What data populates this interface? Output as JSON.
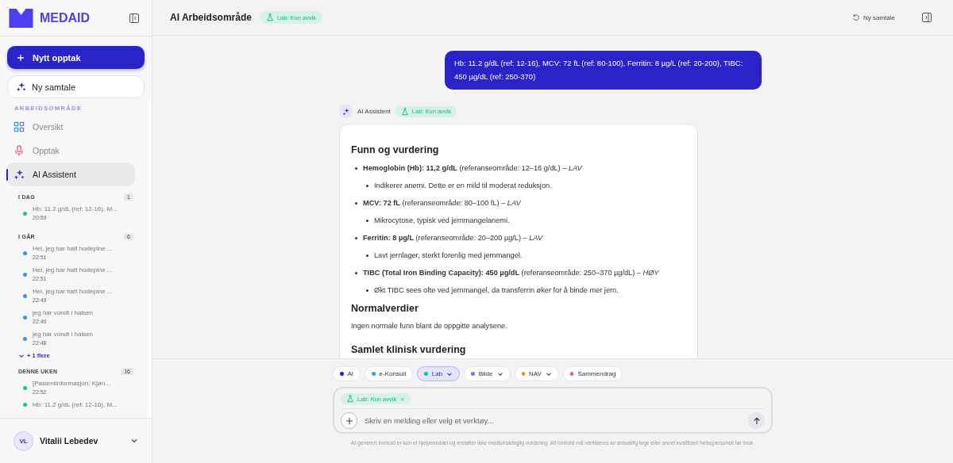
{
  "sidebar": {
    "logo": "MEDAID",
    "new_recording": "Nytt opptak",
    "new_chat": "Ny samtale",
    "section": "ARBEIDSOMRÅDE",
    "nav": [
      {
        "label": "Oversikt",
        "kind": "grid",
        "selected": false
      },
      {
        "label": "Opptak",
        "kind": "mic",
        "selected": false
      },
      {
        "label": "AI Assistent",
        "kind": "sparkle",
        "selected": true
      }
    ],
    "history": [
      {
        "label": "I DAG",
        "count": "1",
        "items": [
          {
            "title": "Hb: 11.2 g/dL (ref: 12-16), M...",
            "time": "20:59",
            "color": "#10c98a"
          }
        ]
      },
      {
        "label": "I GÅR",
        "count": "6",
        "items": [
          {
            "title": "Hei, jeg har hatt hodepine ...",
            "time": "22:51",
            "color": "#3b8ef5"
          },
          {
            "title": "Hei, jeg har hatt hodepine ...",
            "time": "22:51",
            "color": "#3b8ef5"
          },
          {
            "title": "Hei, jeg har hatt hodepine ...",
            "time": "22:49",
            "color": "#3b8ef5"
          },
          {
            "title": "jeg har vondt i halsen",
            "time": "22:49",
            "color": "#3b8ef5"
          },
          {
            "title": "jeg har vondt i halsen",
            "time": "22:48",
            "color": "#3b8ef5"
          }
        ],
        "more": "+ 1 flere"
      },
      {
        "label": "DENNE UKEN",
        "count": "16",
        "items": [
          {
            "title": "[Pasientinformasjon: Kjøn...",
            "time": "22:52",
            "color": "#10c98a"
          },
          {
            "title": "Hb: 11.2 g/dL (ref: 12-16), M...",
            "color": "#10c98a"
          }
        ]
      }
    ],
    "user": {
      "initials": "VL",
      "name": "Vitalii Lebedev"
    }
  },
  "header": {
    "title": "AI Arbeidsområde",
    "badge": "Lab: Kun avvik",
    "new_chat": "Ny samtale"
  },
  "user_message": "Hb: 11.2 g/dL (ref: 12-16), MCV: 72 fL (ref: 80-100), Ferritin: 8 µg/L (ref: 20-200), TIBC: 450 µg/dL (ref: 250-370)",
  "assistant": {
    "name": "AI Assistent",
    "badge": "Lab: Kun avvik",
    "blocks": [
      {
        "kind": "heading",
        "text": "Funn og vurdering"
      },
      {
        "kind": "bullet",
        "text": "**Hemoglobin (Hb): 11,2 g/dL** (referanseområde: 12–16 g/dL) – *LAV*"
      },
      {
        "kind": "subbullet",
        "text": "Indikerer anemi. Dette er en mild til moderat reduksjon."
      },
      {
        "kind": "bullet",
        "text": "**MCV: 72 fL** (referanseområde: 80–100 fL) – *LAV*"
      },
      {
        "kind": "subbullet",
        "text": "Mikrocytose, typisk ved jernmangelanemi."
      },
      {
        "kind": "bullet",
        "text": "**Ferritin: 8 µg/L** (referanseområde: 20–200 µg/L) – *LAV*"
      },
      {
        "kind": "subbullet",
        "text": "Lavt jernlager, sterkt forenlig med jernmangel."
      },
      {
        "kind": "bullet",
        "text": "**TIBC (Total Iron Binding Capacity): 450 µg/dL** (referanseområde: 250–370 µg/dL) – *HØY*"
      },
      {
        "kind": "subbullet",
        "text": "Økt TIBC sees ofte ved jernmangel, da transferrin øker for å binde mer jern."
      },
      {
        "kind": "heading",
        "text": "Normalverdier"
      },
      {
        "kind": "paragraph",
        "text": "Ingen normale funn blant de oppgitte analysene."
      },
      {
        "kind": "heading",
        "text": "Samlet klinisk vurdering"
      }
    ]
  },
  "composer": {
    "tools": [
      {
        "label": "AI",
        "color": "#2323c8",
        "selected": false,
        "dropdown": false
      },
      {
        "label": "e-Konsult",
        "color": "#3b9cf5",
        "selected": false,
        "dropdown": false
      },
      {
        "label": "Lab",
        "color": "#10c98a",
        "selected": true,
        "dropdown": true
      },
      {
        "label": "Bilde",
        "color": "#8b6cf0",
        "selected": false,
        "dropdown": true
      },
      {
        "label": "NAV",
        "color": "#f58a0b",
        "selected": false,
        "dropdown": true
      },
      {
        "label": "Sammendrag",
        "color": "#f0566e",
        "selected": false,
        "dropdown": false
      }
    ],
    "chip": "Lab: Kun avvik",
    "placeholder": "Skriv en melding eller velg et verktøy...",
    "disclaimer": "AI-generert innhold er kun et hjelpemiddel og erstatter ikke medisinskfaglig vurdering. Alt innhold må verifiseres av ansvarlig lege eller annet kvalifisert helsepersonell før bruk."
  }
}
